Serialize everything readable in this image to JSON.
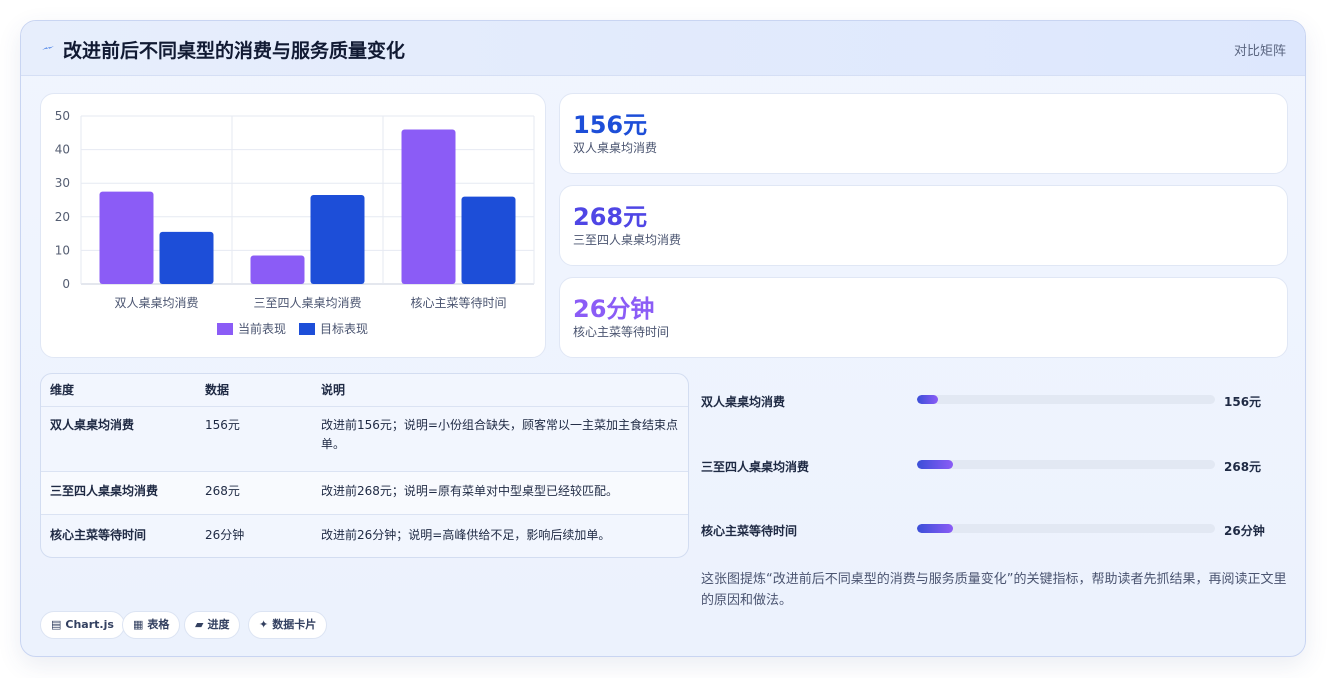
{
  "header": {
    "title": "改进前后不同桌型的消费与服务质量变化",
    "right_label": "对比矩阵"
  },
  "colors": {
    "current": "#8b5cf6",
    "target": "#1d4ed8",
    "kpi_1": "#1d4ed8",
    "kpi_2": "#4f46e5",
    "kpi_3": "#8b5cf6"
  },
  "chart_data": {
    "type": "bar",
    "categories": [
      "双人桌桌均消费",
      "三至四人桌桌均消费",
      "核心主菜等待时间"
    ],
    "series": [
      {
        "name": "当前表现",
        "values": [
          27.5,
          8.5,
          46
        ]
      },
      {
        "name": "目标表现",
        "values": [
          15.5,
          26.5,
          26
        ]
      }
    ],
    "yticks": [
      "0",
      "10",
      "20",
      "30",
      "40",
      "50"
    ],
    "ylim": [
      0,
      50
    ],
    "grid": true,
    "legend": "bottom"
  },
  "kpis": [
    {
      "value": "156元",
      "label": "双人桌桌均消费"
    },
    {
      "value": "268元",
      "label": "三至四人桌桌均消费"
    },
    {
      "value": "26分钟",
      "label": "核心主菜等待时间"
    }
  ],
  "table": {
    "headers": [
      "维度",
      "数据",
      "说明"
    ],
    "rows": [
      {
        "dimension": "双人桌桌均消费",
        "data": "156元",
        "note": "改进前156元；说明=小份组合缺失，顾客常以一主菜加主食结束点单。"
      },
      {
        "dimension": "三至四人桌桌均消费",
        "data": "268元",
        "note": "改进前268元；说明=原有菜单对中型桌型已经较匹配。"
      },
      {
        "dimension": "核心主菜等待时间",
        "data": "26分钟",
        "note": "改进前26分钟；说明=高峰供给不足，影响后续加单。"
      }
    ]
  },
  "progress": [
    {
      "label": "双人桌桌均消费",
      "value": "156元",
      "fraction": 0.07
    },
    {
      "label": "三至四人桌桌均消费",
      "value": "268元",
      "fraction": 0.12
    },
    {
      "label": "核心主菜等待时间",
      "value": "26分钟",
      "fraction": 0.12
    }
  ],
  "note": "这张图提炼“改进前后不同桌型的消费与服务质量变化”的关键指标，帮助读者先抓结果，再阅读正文里的原因和做法。",
  "chips": [
    {
      "icon": "▤",
      "label": "Chart.js"
    },
    {
      "icon": "▦",
      "label": "表格"
    },
    {
      "icon": "▰",
      "label": "进度"
    },
    {
      "icon": "✦",
      "label": "数据卡片"
    }
  ]
}
